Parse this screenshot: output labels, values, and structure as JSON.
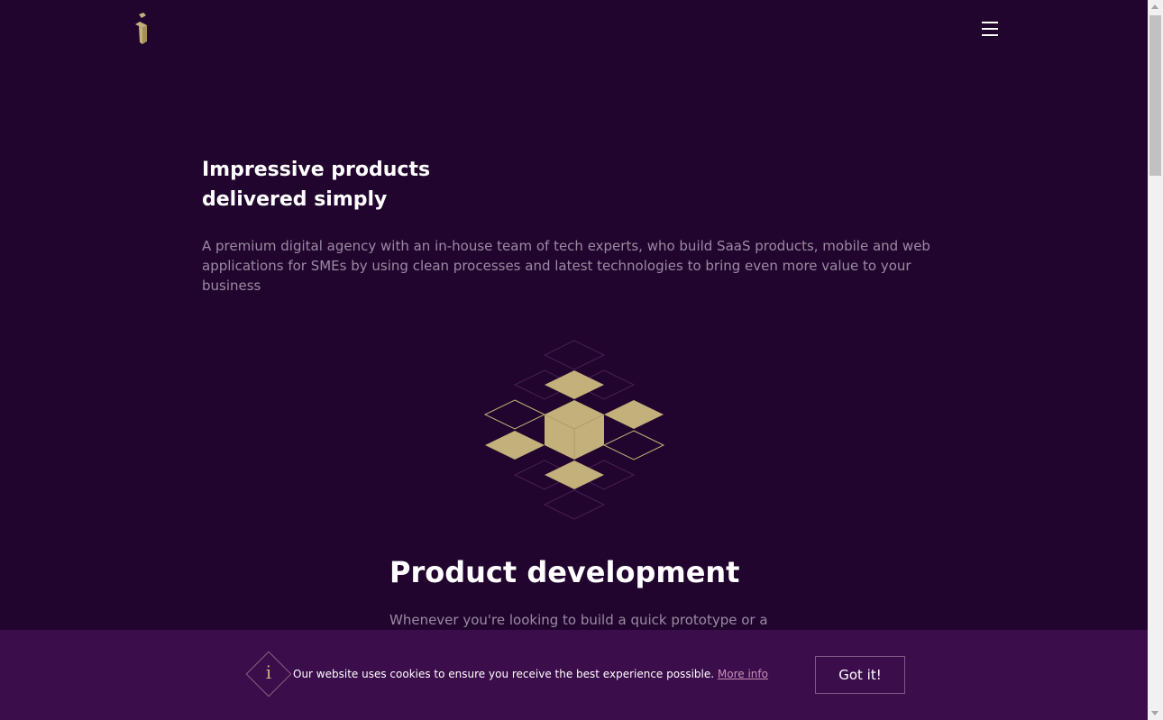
{
  "header": {
    "logo_icon": "brand-logo-icon",
    "menu_icon": "hamburger-menu-icon"
  },
  "hero": {
    "title_line1": "Impressive products",
    "title_line2": "delivered simply",
    "description": "A premium digital agency with an in-house team of tech experts, who build SaaS products, mobile and web applications for SMEs by using clean processes and latest technologies to bring even more value to your business"
  },
  "section": {
    "illustration_icon": "isometric-cubes-icon",
    "title": "Product development",
    "description": "Whenever you're looking to build a quick prototype or a"
  },
  "cookie": {
    "icon": "info-icon",
    "icon_glyph": "i",
    "text": "Our website uses cookies to ensure you receive the best experience possible.",
    "link": "More info",
    "button": "Got it!"
  },
  "colors": {
    "background": "#21052e",
    "cookie_bar": "#3c0d4b",
    "gold": "#c4b07a",
    "muted_text": "#9b8aa3",
    "link": "#c98fb7"
  }
}
